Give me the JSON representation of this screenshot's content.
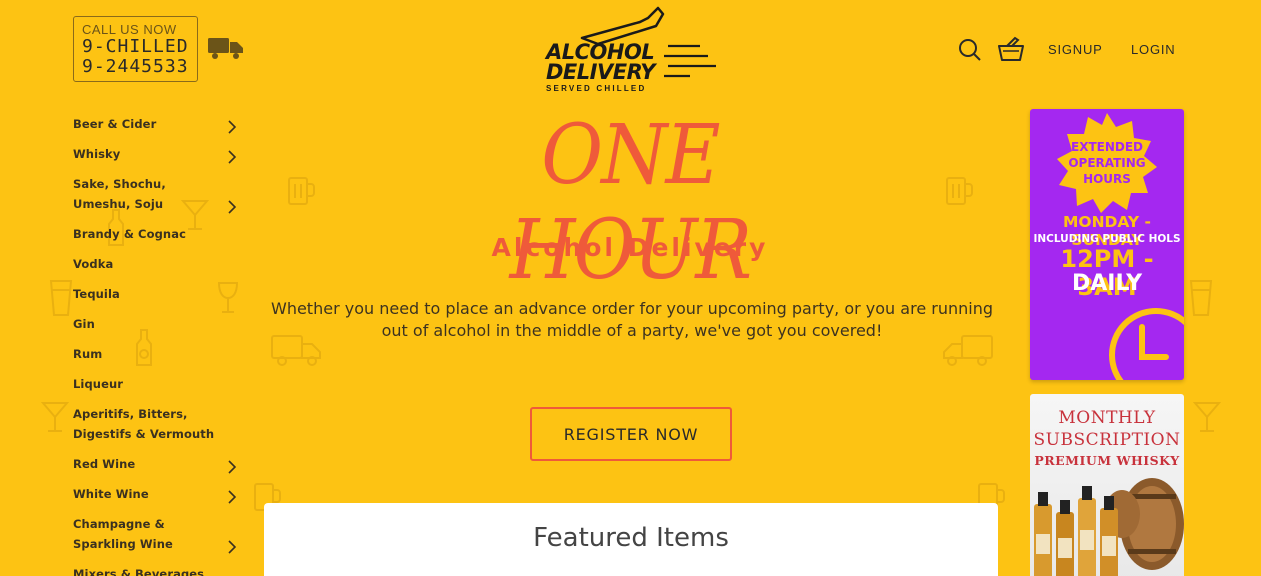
{
  "contact": {
    "label": "CALL US NOW",
    "line1": "9-CHILLED",
    "line2": "9-2445533"
  },
  "logo": {
    "line1": "ALCOHOL",
    "line2": "DELIVERY",
    "tagline": "SERVED CHILLED"
  },
  "header": {
    "signup": "SIGNUP",
    "login": "LOGIN"
  },
  "sidebar": {
    "items": [
      {
        "label": "Beer & Cider",
        "has_submenu": true
      },
      {
        "label": "Whisky",
        "has_submenu": true
      },
      {
        "label": "Sake, Shochu, Umeshu, Soju",
        "has_submenu": true
      },
      {
        "label": "Brandy & Cognac",
        "has_submenu": false
      },
      {
        "label": "Vodka",
        "has_submenu": false
      },
      {
        "label": "Tequila",
        "has_submenu": false
      },
      {
        "label": "Gin",
        "has_submenu": false
      },
      {
        "label": "Rum",
        "has_submenu": false
      },
      {
        "label": "Liqueur",
        "has_submenu": false
      },
      {
        "label": "Aperitifs, Bitters, Digestifs & Vermouth",
        "has_submenu": false
      },
      {
        "label": "Red Wine",
        "has_submenu": true
      },
      {
        "label": "White Wine",
        "has_submenu": true
      },
      {
        "label": "Champagne & Sparkling Wine",
        "has_submenu": true
      },
      {
        "label": "Mixers & Beverages",
        "has_submenu": false
      }
    ]
  },
  "hero": {
    "title": "ONE HOUR",
    "subtitle": "Alcohol Delivery",
    "description": "Whether you need to place an advance order for your upcoming party, or you are running out of alcohol in the middle of a party, we've got you covered!",
    "cta": "REGISTER NOW"
  },
  "featured": {
    "title": "Featured Items"
  },
  "banner_hours": {
    "badge": "EXTENDED OPERATING HOURS",
    "days": "MONDAY - SUNDAY",
    "holidays": "INCLUDING PUBLIC HOLS",
    "time": "12PM - 3AM",
    "frequency": "DAILY"
  },
  "banner_subscription": {
    "title": "MONTHLY SUBSCRIPTION",
    "subtitle": "PREMIUM WHISKY"
  },
  "colors": {
    "background": "#fdc313",
    "accent": "#ef5a3a",
    "purple": "#a428f0"
  }
}
